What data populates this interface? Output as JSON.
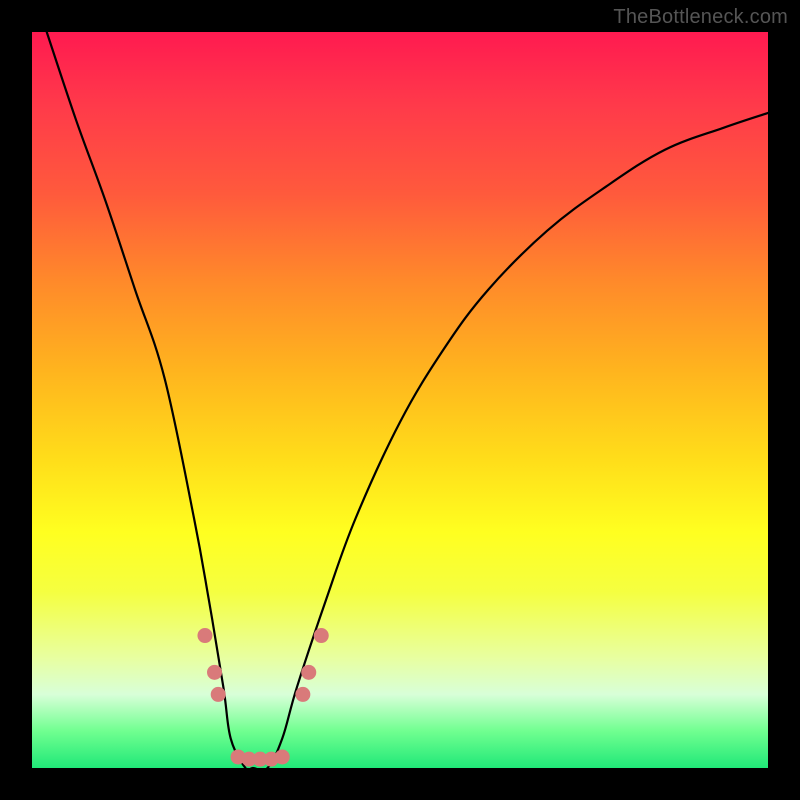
{
  "watermark": {
    "text": "TheBottleneck.com"
  },
  "chart_data": {
    "type": "line",
    "title": "",
    "xlabel": "",
    "ylabel": "",
    "ylim": [
      0,
      100
    ],
    "xlim": [
      0,
      100
    ],
    "series": [
      {
        "name": "bottleneck-curve",
        "x": [
          2,
          6,
          10,
          14,
          18,
          22,
          24,
          26,
          27,
          29,
          30,
          32,
          34,
          36,
          40,
          44,
          50,
          56,
          62,
          70,
          78,
          86,
          94,
          100
        ],
        "values": [
          100,
          88,
          77,
          65,
          53,
          34,
          23,
          11,
          4,
          0,
          0,
          0,
          4,
          11,
          23,
          34,
          47,
          57,
          65,
          73,
          79,
          84,
          87,
          89
        ]
      }
    ],
    "markers": {
      "name": "highlight-dots",
      "color": "#d97a7a",
      "points": [
        {
          "x": 23.5,
          "y": 18
        },
        {
          "x": 24.8,
          "y": 13
        },
        {
          "x": 25.3,
          "y": 10
        },
        {
          "x": 28.0,
          "y": 1.5
        },
        {
          "x": 29.5,
          "y": 1.2
        },
        {
          "x": 31.0,
          "y": 1.2
        },
        {
          "x": 32.5,
          "y": 1.2
        },
        {
          "x": 34.0,
          "y": 1.5
        },
        {
          "x": 36.8,
          "y": 10
        },
        {
          "x": 37.6,
          "y": 13
        },
        {
          "x": 39.3,
          "y": 18
        }
      ]
    }
  }
}
